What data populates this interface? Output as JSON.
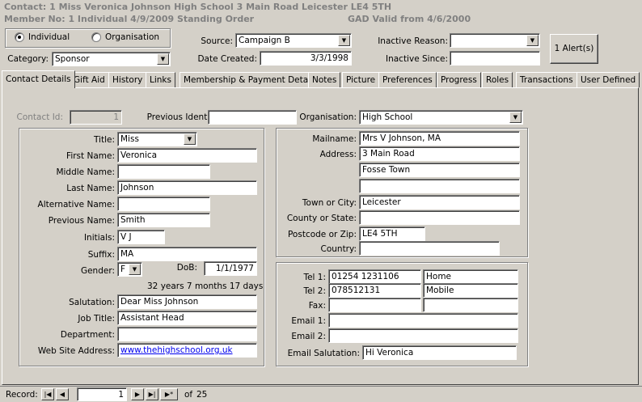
{
  "header": {
    "line1": "Contact: 1 Miss Veronica Johnson High School 3 Main Road Leicester  LE4 5TH",
    "line2": "Member No: 1 Individual 4/9/2009 Standing Order",
    "gad": "GAD Valid from 4/6/2000"
  },
  "type_group": {
    "individual": "Individual",
    "organisation": "Organisation",
    "selected": "Individual"
  },
  "top": {
    "category_label": "Category:",
    "category_value": "Sponsor",
    "source_label": "Source:",
    "source_value": "Campaign B",
    "date_created_label": "Date Created:",
    "date_created_value": "3/3/1998",
    "inactive_reason_label": "Inactive Reason:",
    "inactive_reason_value": "",
    "inactive_since_label": "Inactive Since:",
    "inactive_since_value": "",
    "alerts_button": "1 Alert(s)"
  },
  "tabs": [
    "Contact Details",
    "Gift Aid",
    "History",
    "Links",
    "Membership & Payment Details",
    "Notes",
    "Picture",
    "Preferences",
    "Progress",
    "Roles",
    "Transactions",
    "User Defined"
  ],
  "ids": {
    "contact_id_label": "Contact Id:",
    "contact_id_value": "1",
    "previous_identifier_label": "Previous Identifier:",
    "previous_identifier_value": "",
    "organisation_label": "Organisation:",
    "organisation_value": "High School"
  },
  "person": {
    "title_label": "Title:",
    "title_value": "Miss",
    "first_name_label": "First Name:",
    "first_name_value": "Veronica",
    "middle_name_label": "Middle Name:",
    "middle_name_value": "",
    "last_name_label": "Last Name:",
    "last_name_value": "Johnson",
    "alternative_name_label": "Alternative Name:",
    "alternative_name_value": "",
    "previous_name_label": "Previous Name:",
    "previous_name_value": "Smith",
    "initials_label": "Initials:",
    "initials_value": "V J",
    "suffix_label": "Suffix:",
    "suffix_value": "MA",
    "gender_label": "Gender:",
    "gender_value": "F",
    "dob_label": "DoB:",
    "dob_value": "1/1/1977",
    "age_text": "32 years 7 months 17 days",
    "salutation_label": "Salutation:",
    "salutation_value": "Dear Miss Johnson",
    "job_title_label": "Job Title:",
    "job_title_value": "Assistant Head",
    "department_label": "Department:",
    "department_value": "",
    "website_label": "Web Site Address:",
    "website_value": "www.thehighschool.org.uk"
  },
  "address": {
    "mailname_label": "Mailname:",
    "mailname_value": "Mrs V Johnson, MA",
    "address_label": "Address:",
    "address_line1": "3 Main Road",
    "address_line2": "Fosse Town",
    "address_line3": "",
    "town_label": "Town or City:",
    "town_value": "Leicester",
    "county_label": "County or State:",
    "county_value": "",
    "postcode_label": "Postcode or Zip:",
    "postcode_value": "LE4 5TH",
    "country_label": "Country:",
    "country_value": ""
  },
  "contact": {
    "tel1_label": "Tel 1:",
    "tel1_value": "01254 1231106",
    "tel1_type": "Home",
    "tel2_label": "Tel 2:",
    "tel2_value": "078512131",
    "tel2_type": "Mobile",
    "fax_label": "Fax:",
    "fax_value": "",
    "fax_type": "",
    "email1_label": "Email 1:",
    "email1_value": "",
    "email2_label": "Email 2:",
    "email2_value": "",
    "email_salutation_label": "Email Salutation:",
    "email_salutation_value": "Hi Veronica"
  },
  "nav": {
    "record_label": "Record:",
    "current": "1",
    "of_label": "of",
    "total": "25"
  }
}
